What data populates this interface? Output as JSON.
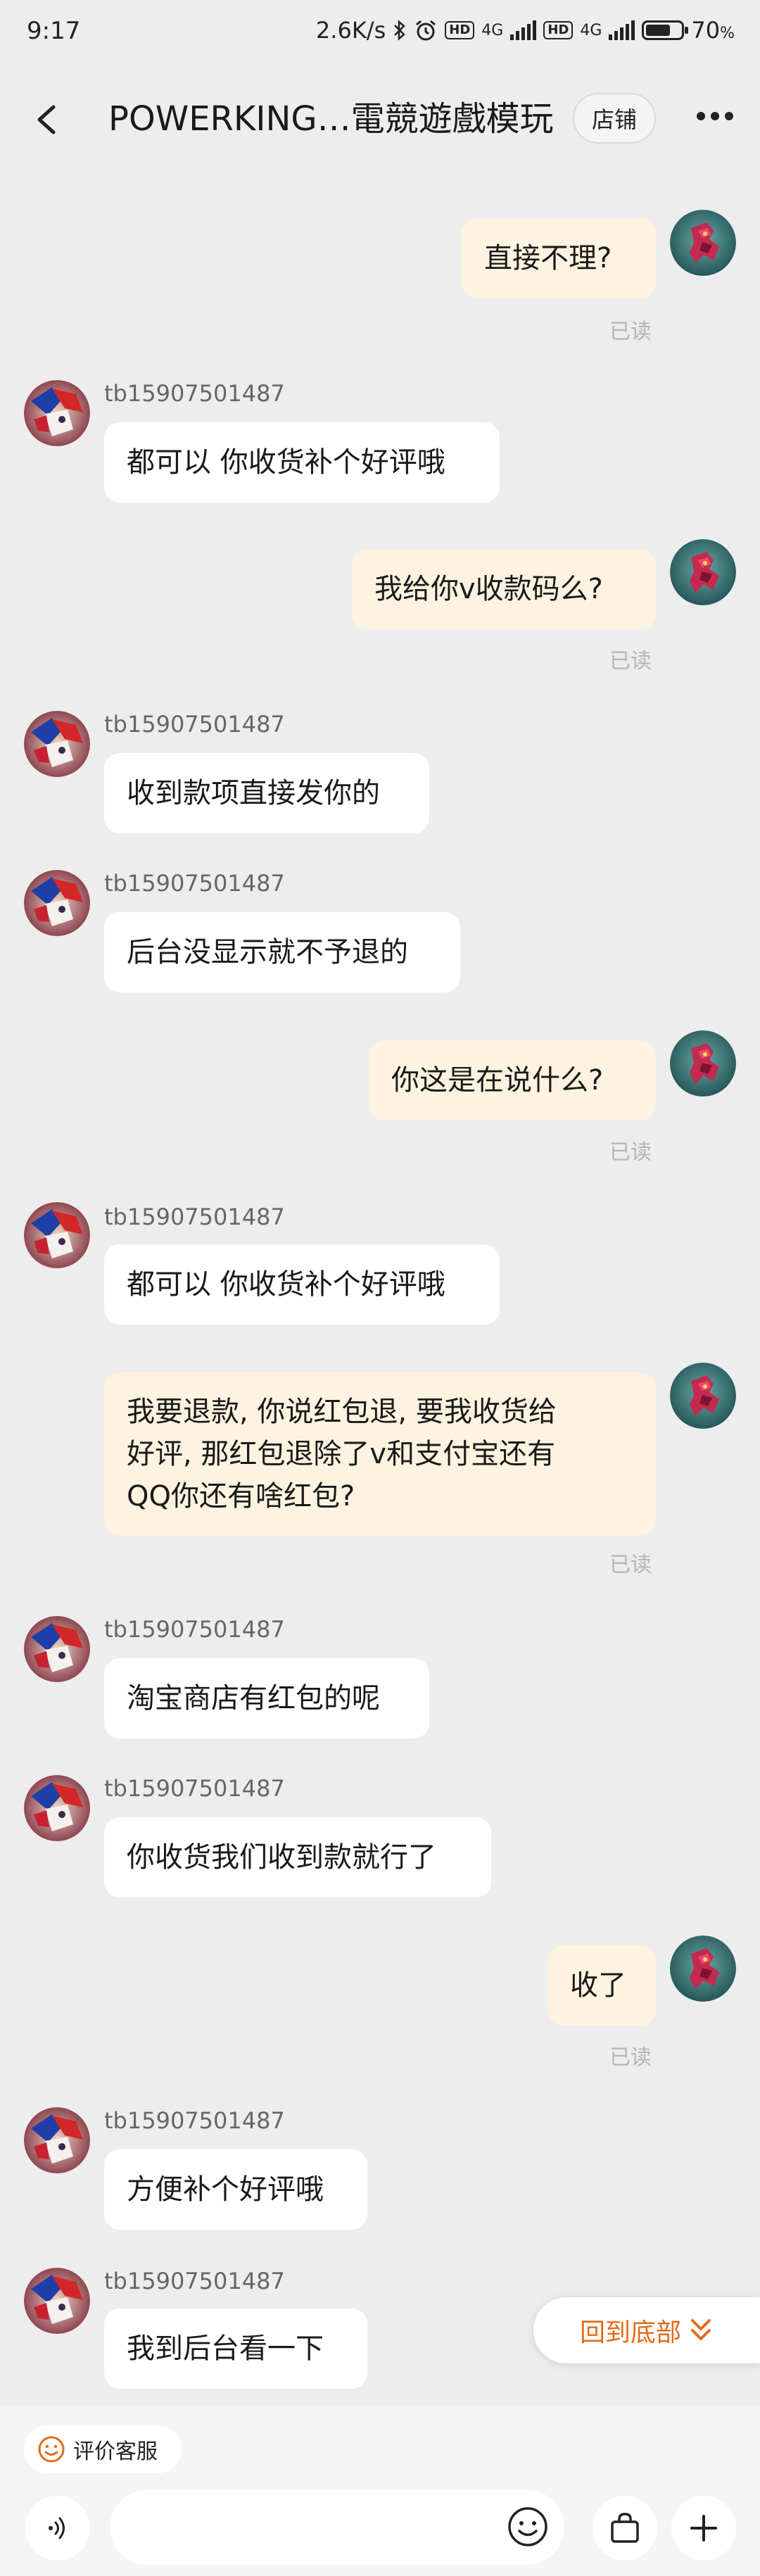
{
  "status": {
    "time": "9:17",
    "net_speed": "2.6K/s",
    "hd1": "HD",
    "lte1": "4G",
    "hd2": "HD",
    "lte2": "4G",
    "battery": "70",
    "battery_unit": "%",
    "battery_level": 0.7
  },
  "header": {
    "title": "POWERKING…電競遊戲模玩",
    "shop_label": "店铺",
    "back_icon": "chevron-left-icon",
    "more_icon": "more-dots-icon"
  },
  "messages": [
    {
      "side": "right",
      "text": "直接不理?",
      "read": "已读"
    },
    {
      "side": "left",
      "sender": "tb15907501487",
      "text": "都可以 你收货补个好评哦"
    },
    {
      "side": "right",
      "text": "我给你v收款码么?",
      "read": "已读"
    },
    {
      "side": "left",
      "sender": "tb15907501487",
      "text": "收到款项直接发你的"
    },
    {
      "side": "left",
      "sender": "tb15907501487",
      "text": "后台没显示就不予退的"
    },
    {
      "side": "right",
      "text": "你这是在说什么?",
      "read": "已读"
    },
    {
      "side": "left",
      "sender": "tb15907501487",
      "text": "都可以 你收货补个好评哦"
    },
    {
      "side": "right",
      "lines": [
        "我要退款, 你说红包退, 要我收货给",
        "好评, 那红包退除了v和支付宝还有",
        "QQ你还有啥红包?"
      ],
      "read": "已读"
    },
    {
      "side": "left",
      "sender": "tb15907501487",
      "text": "淘宝商店有红包的呢"
    },
    {
      "side": "left",
      "sender": "tb15907501487",
      "text": "你收货我们收到款就行了"
    },
    {
      "side": "right",
      "text": "收了",
      "read": "已读"
    },
    {
      "side": "left",
      "sender": "tb15907501487",
      "text": "方便补个好评哦"
    },
    {
      "side": "left",
      "sender": "tb15907501487",
      "text": "我到后台看一下"
    }
  ],
  "back_to_bottom": {
    "label": "回到底部",
    "icon": "double-chevron-down-icon"
  },
  "bottom": {
    "rate_label": "评价客服",
    "rate_icon": "smile-icon",
    "voice_icon": "voice-icon",
    "emoji_icon": "emoji-icon",
    "bag_icon": "shopping-bag-icon",
    "plus_icon": "plus-icon"
  },
  "colors": {
    "background": "#ededed",
    "bubble_right": "#fdf3e0",
    "bubble_left": "#ffffff",
    "accent": "#e26b1b",
    "read_text": "#b5b5b5"
  }
}
